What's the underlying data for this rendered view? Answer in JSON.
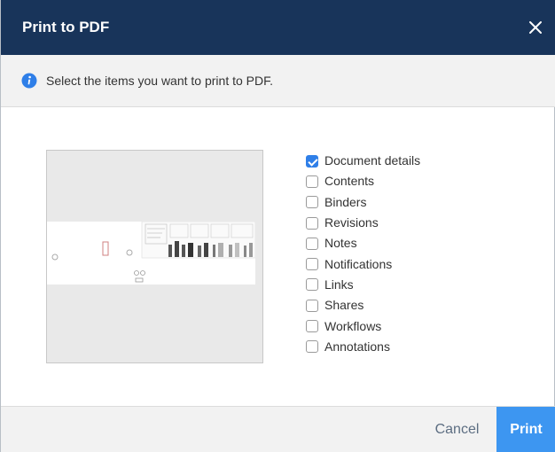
{
  "dialog": {
    "title": "Print to PDF",
    "close_icon": "close-icon"
  },
  "info": {
    "icon": "info-icon",
    "text": "Select the items you want to print to PDF."
  },
  "preview": {
    "description_icon": "thumbnail-preview"
  },
  "options": [
    {
      "label": "Document details",
      "checked": true
    },
    {
      "label": "Contents",
      "checked": false
    },
    {
      "label": "Binders",
      "checked": false
    },
    {
      "label": "Revisions",
      "checked": false
    },
    {
      "label": "Notes",
      "checked": false
    },
    {
      "label": "Notifications",
      "checked": false
    },
    {
      "label": "Links",
      "checked": false
    },
    {
      "label": "Shares",
      "checked": false
    },
    {
      "label": "Workflows",
      "checked": false
    },
    {
      "label": "Annotations",
      "checked": false
    }
  ],
  "footer": {
    "cancel_label": "Cancel",
    "print_label": "Print"
  },
  "colors": {
    "header": "#18345a",
    "accent": "#3d96f1",
    "checkbox_checked": "#2f7fe8"
  }
}
